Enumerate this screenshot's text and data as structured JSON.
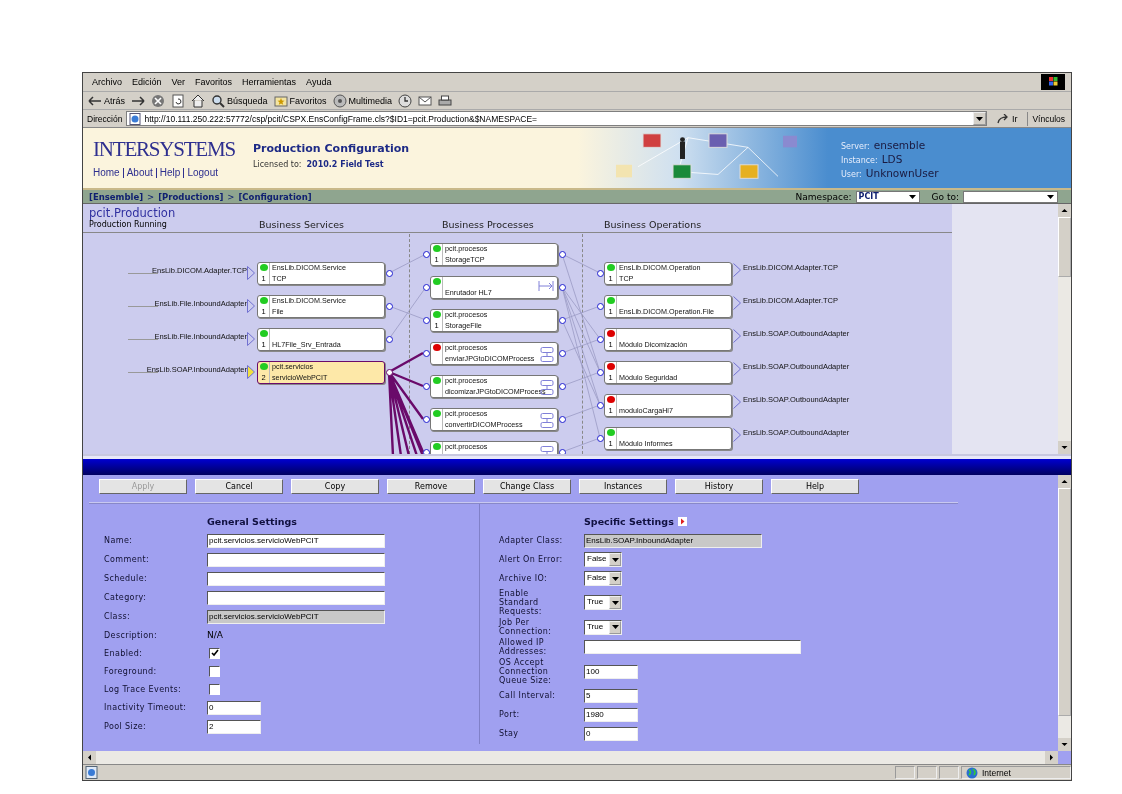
{
  "browser": {
    "menu": [
      "Archivo",
      "Edición",
      "Ver",
      "Favoritos",
      "Herramientas",
      "Ayuda"
    ],
    "toolbar": [
      {
        "kind": "back",
        "label": "Atrás"
      },
      {
        "kind": "forward"
      },
      {
        "kind": "stop"
      },
      {
        "kind": "refresh"
      },
      {
        "kind": "home"
      },
      {
        "kind": "search",
        "label": "Búsqueda"
      },
      {
        "kind": "favorites",
        "label": "Favoritos"
      },
      {
        "kind": "media",
        "label": "Multimedia"
      },
      {
        "kind": "history"
      },
      {
        "kind": "mail"
      },
      {
        "kind": "print"
      }
    ],
    "address_label": "Dirección",
    "url": "http://10.111.250.222:57772/csp/pcit/CSPX.EnsConfigFrame.cls?$ID1=pcit.Production&$NAMESPACE=",
    "go": "Ir",
    "links": "Vínculos",
    "status": "Internet"
  },
  "header": {
    "logo": "INTERSYSTEMS",
    "nav": [
      "Home",
      "About",
      "Help",
      "Logout"
    ],
    "title": "Production Configuration",
    "license_label": "Licensed to:",
    "license": "2010.2 Field Test",
    "server_info": [
      {
        "label": "Server:",
        "value": "ensemble"
      },
      {
        "label": "Instance:",
        "value": "LDS"
      },
      {
        "label": "User:",
        "value": "UnknownUser"
      }
    ]
  },
  "breadcrumb": [
    {
      "kind": "link",
      "text": "[Ensemble]"
    },
    {
      "kind": "sep",
      "text": ">"
    },
    {
      "kind": "link",
      "text": "[Productions]"
    },
    {
      "kind": "sep",
      "text": ">"
    },
    {
      "kind": "link",
      "text": "[Configuration]"
    }
  ],
  "namespace": {
    "label": "Namespace:",
    "value": "PCIT"
  },
  "goto": {
    "label": "Go to:"
  },
  "diagram": {
    "title": "pcit.Production",
    "status": "Production Running",
    "columns": [
      "Business Services",
      "Business Processes",
      "Business Operations"
    ],
    "services": [
      {
        "adapter": "EnsLib.DICOM.Adapter.TCP",
        "package": "EnsLib.DICOM.Service",
        "name": "TCP",
        "count": "1",
        "color": "#22cc22",
        "selected": false
      },
      {
        "adapter": "EnsLib.File.InboundAdapter",
        "package": "EnsLib.DICOM.Service",
        "name": "File",
        "count": "1",
        "color": "#22cc22",
        "selected": false
      },
      {
        "adapter": "EnsLib.File.InboundAdapter",
        "name": "HL7File_Srv_Entrada",
        "count": "1",
        "color": "#22cc22",
        "selected": false
      },
      {
        "adapter": "EnsLib.SOAP.InboundAdapter",
        "package": "pcit.servicios",
        "name": "servicioWebPCIT",
        "count": "2",
        "color": "#22cc22",
        "selected": true
      }
    ],
    "processes": [
      {
        "kind": "plain",
        "package": "pcit.procesos",
        "name": "StorageTCP",
        "count": "1",
        "color": "#22cc22",
        "selected": false
      },
      {
        "kind": "router",
        "name": "Enrutador HL7",
        "color": "#22cc22",
        "selected": false
      },
      {
        "kind": "plain",
        "package": "pcit.procesos",
        "name": "StorageFile",
        "count": "1",
        "color": "#22cc22",
        "selected": false
      },
      {
        "kind": "bpl",
        "package": "pcit.procesos",
        "name": "enviarJPGtoDICOMProcess",
        "color": "#dd0000",
        "selected": false
      },
      {
        "kind": "bpl",
        "package": "pcit.procesos",
        "name": "dicomizarJPGtoDICOMProcess",
        "color": "#22cc22",
        "selected": false
      },
      {
        "kind": "bpl",
        "package": "pcit.procesos",
        "name": "convertirDICOMProcess",
        "color": "#22cc22",
        "selected": false
      },
      {
        "kind": "bpl",
        "package": "pcit.procesos",
        "color": "#22cc22",
        "selected": false
      }
    ],
    "operations": [
      {
        "adapter": "EnsLib.DICOM.Adapter.TCP",
        "package": "EnsLib.DICOM.Operation",
        "name": "TCP",
        "count": "1",
        "color": "#22cc22",
        "selected": false
      },
      {
        "adapter": "EnsLib.DICOM.Adapter.TCP",
        "name": "EnsLib.DICOM.Operation.File",
        "count": "1",
        "color": "#22cc22",
        "selected": false
      },
      {
        "adapter": "EnsLib.SOAP.OutboundAdapter",
        "name": "Módulo Dicomización",
        "count": "1",
        "color": "#dd0000",
        "selected": false
      },
      {
        "adapter": "EnsLib.SOAP.OutboundAdapter",
        "name": "Módulo Seguridad",
        "count": "1",
        "color": "#dd0000",
        "selected": false
      },
      {
        "adapter": "EnsLib.SOAP.OutboundAdapter",
        "name": "moduloCargaHl7",
        "count": "1",
        "color": "#dd0000",
        "selected": false
      },
      {
        "adapter": "EnsLib.SOAP.OutboundAdapter",
        "name": "Módulo Informes",
        "count": "1",
        "color": "#22cc22",
        "selected": false
      }
    ]
  },
  "buttons": [
    {
      "label": "Apply",
      "disabled": true
    },
    {
      "label": "Cancel",
      "disabled": false
    },
    {
      "label": "Copy",
      "disabled": false
    },
    {
      "label": "Remove",
      "disabled": false
    },
    {
      "label": "Change Class",
      "disabled": false
    },
    {
      "label": "Instances",
      "disabled": false
    },
    {
      "label": "History",
      "disabled": false
    },
    {
      "label": "Help",
      "disabled": false
    }
  ],
  "general": {
    "title": "General Settings",
    "fields": [
      {
        "kind": "text",
        "label": "Name:",
        "value": "pcit.servicios.servicioWebPCIT"
      },
      {
        "kind": "text",
        "label": "Comment:"
      },
      {
        "kind": "text",
        "label": "Schedule:"
      },
      {
        "kind": "text",
        "label": "Category:"
      },
      {
        "kind": "readonly",
        "label": "Class:",
        "value": "pcit.servicios.servicioWebPCIT"
      },
      {
        "kind": "static",
        "label": "Description:",
        "value": "N/A"
      },
      {
        "kind": "checkbox",
        "label": "Enabled:",
        "checked": true
      },
      {
        "kind": "checkbox",
        "label": "Foreground:",
        "checked": false
      },
      {
        "kind": "checkbox",
        "label": "Log Trace Events:",
        "checked": false
      },
      {
        "kind": "short",
        "label": "Inactivity Timeout:",
        "value": "0"
      },
      {
        "kind": "short",
        "label": "Pool Size:",
        "value": "2"
      }
    ]
  },
  "specific": {
    "title": "Specific Settings",
    "fields": [
      {
        "kind": "readonly",
        "label": "Adapter Class:",
        "value": "EnsLib.SOAP.InboundAdapter"
      },
      {
        "kind": "select",
        "label": "Alert On Error:",
        "value": "False"
      },
      {
        "kind": "select",
        "label": "Archive IO:",
        "value": "False"
      },
      {
        "kind": "select",
        "label": "Enable Standard Requests:",
        "value": "True"
      },
      {
        "kind": "select",
        "label": "Job Per Connection:",
        "value": "True"
      },
      {
        "kind": "text",
        "label": "Allowed IP Addresses:"
      },
      {
        "kind": "short",
        "label": "OS Accept Connection Queue Size:",
        "value": "100"
      },
      {
        "kind": "short",
        "label": "Call Interval:",
        "value": "5"
      },
      {
        "kind": "short",
        "label": "Port:",
        "value": "1980"
      },
      {
        "kind": "short",
        "label": "Stay",
        "value": "0"
      }
    ]
  }
}
